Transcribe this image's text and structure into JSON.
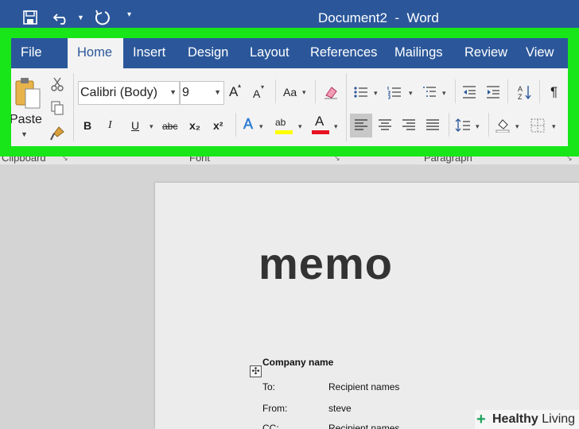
{
  "title_bar": {
    "document_title": "Document2  -  Word",
    "quick_access": [
      "save-icon",
      "undo-icon",
      "redo-icon",
      "customize-icon"
    ]
  },
  "tabs": [
    "File",
    "Home",
    "Insert",
    "Design",
    "Layout",
    "References",
    "Mailings",
    "Review",
    "View"
  ],
  "active_tab": "Home",
  "clipboard": {
    "paste_label": "Paste",
    "icons": [
      "cut-icon",
      "copy-icon",
      "format-painter-icon"
    ]
  },
  "font": {
    "family": "Calibri (Body)",
    "size": "9",
    "grow_label": "A",
    "shrink_label": "A",
    "change_case_label": "Aa",
    "bold_label": "B",
    "italic_label": "I",
    "underline_label": "U",
    "strike_label": "abc",
    "subscript_label": "x₂",
    "superscript_label": "x²",
    "text_effects_label": "A",
    "highlight_label": "ab",
    "font_color_label": "A",
    "highlight_color": "#ffff00",
    "font_color": "#e81123"
  },
  "paragraph": {
    "sort_label": "A↓Z",
    "pilcrow": "¶"
  },
  "group_labels": {
    "clipboard": "Clipboard",
    "font": "Font",
    "paragraph": "Paragraph"
  },
  "document": {
    "heading": "memo",
    "company_name": "Company name",
    "rows": [
      {
        "label": "To:",
        "value": "Recipient names"
      },
      {
        "label": "From:",
        "value": "steve"
      },
      {
        "label": "CC:",
        "value": "Recipient names"
      }
    ]
  },
  "watermark": {
    "part1": "Healthy",
    "part2": " Living"
  },
  "colors": {
    "title_bar": "#2b579a",
    "highlight_frame": "#19e619",
    "ribbon": "#f3f3f3"
  }
}
